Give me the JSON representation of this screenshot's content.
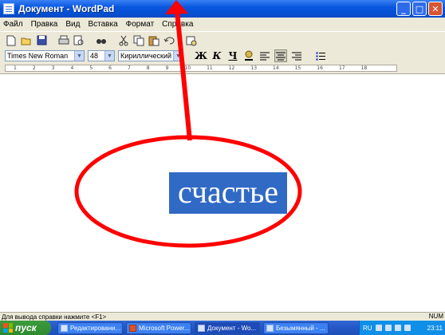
{
  "window": {
    "title": "Документ - WordPad",
    "minimize": "_",
    "maximize": "□",
    "close": "✕"
  },
  "menu": {
    "items": [
      "Файл",
      "Правка",
      "Вид",
      "Вставка",
      "Формат",
      "Справка"
    ]
  },
  "toolbar": {
    "icons": [
      "new-icon",
      "open-icon",
      "save-icon",
      "print-icon",
      "print-preview-icon",
      "find-icon",
      "cut-icon",
      "copy-icon",
      "paste-icon",
      "undo-icon",
      "date-time-icon"
    ]
  },
  "format": {
    "font_name": "Times New Roman",
    "font_size": "48",
    "script": "Кириллический",
    "bold": "Ж",
    "italic": "К",
    "underline": "Ч"
  },
  "ruler": {
    "marks": [
      "1",
      "2",
      "3",
      "4",
      "5",
      "6",
      "7",
      "8",
      "9",
      "10",
      "11",
      "12",
      "13",
      "14",
      "15",
      "16",
      "17",
      "18"
    ]
  },
  "document": {
    "selected_text": "счастье",
    "selection_color": "#316ac5"
  },
  "annotation": {
    "color": "#ff0000"
  },
  "status": {
    "help_text": "Для вывода справки нажмите <F1>",
    "num": "NUM"
  },
  "taskbar": {
    "start_label": "пуск",
    "tasks": [
      {
        "label": "Редактировани..."
      },
      {
        "label": "Microsoft Power..."
      },
      {
        "label": "Документ - Wo..."
      },
      {
        "label": "Безымянный - ..."
      }
    ],
    "lang": "RU",
    "time": "23:11"
  }
}
